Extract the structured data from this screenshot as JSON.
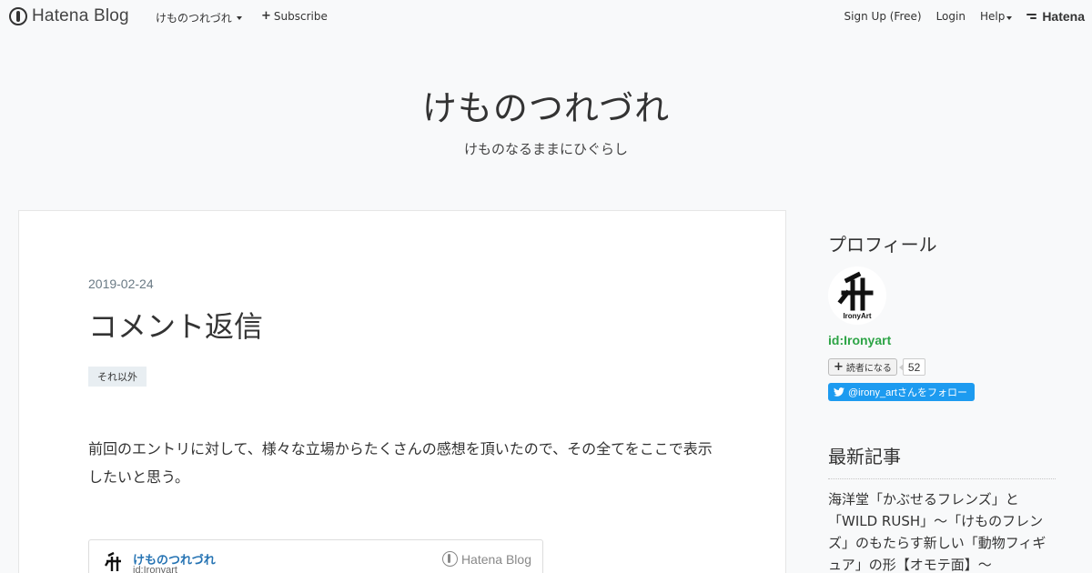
{
  "topbar": {
    "brand": "Hatena Blog",
    "blog_menu": "けものつれづれ",
    "subscribe": "Subscribe",
    "signup": "Sign Up (Free)",
    "login": "Login",
    "help": "Help",
    "hatena": "Hatena"
  },
  "blog": {
    "title": "けものつれづれ",
    "description": "けものなるままにひぐらし"
  },
  "entry": {
    "date": "2019-02-24",
    "title": "コメント返信",
    "category": "それ以外",
    "body": "前回のエントリに対して、様々な立場からたくさんの感想を頂いたので、その全てをここで表示したいと思う。",
    "embed": {
      "title": "けものつれづれ",
      "id": "id:Ironyart",
      "brand": "Hatena Blog"
    }
  },
  "sidebar": {
    "profile_heading": "プロフィール",
    "avatar_text": "IronyArt",
    "profile_id": "id:Ironyart",
    "reader_button": "読者になる",
    "reader_count": "52",
    "twitter_follow": "@irony_artさんをフォロー",
    "recent_heading": "最新記事",
    "recent_entry": "海洋堂「かぶせるフレンズ」と「WILD RUSH」～「けものフレンズ」のもたらす新しい「動物フィギュア」の形【オモテ面】～"
  },
  "colors": {
    "accent_green": "#2da446",
    "link_blue": "#2573b3",
    "twitter_blue": "#1d9bf0"
  }
}
